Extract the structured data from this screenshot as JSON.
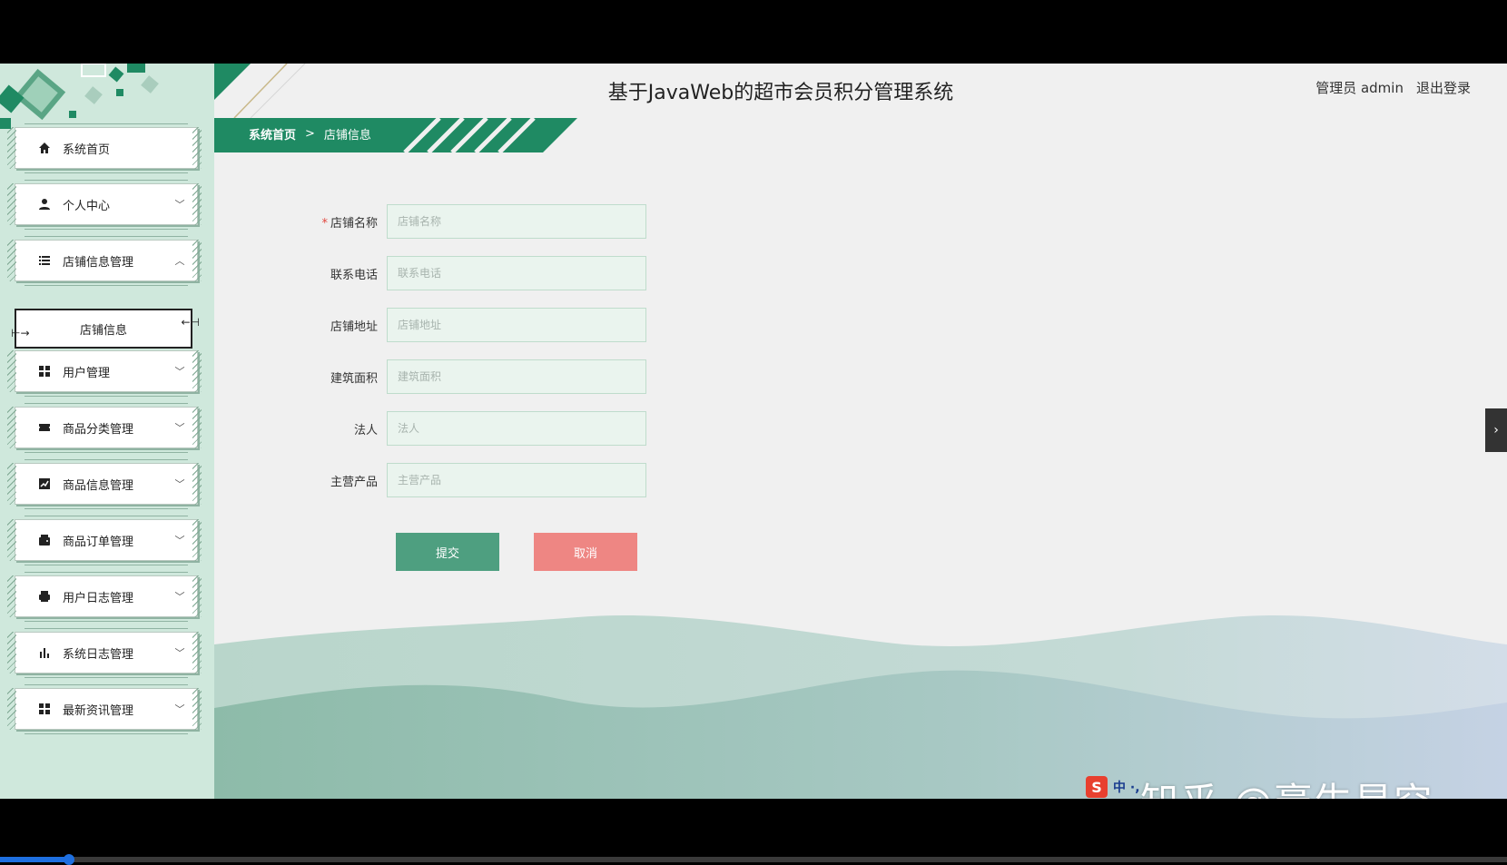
{
  "header": {
    "title": "基于JavaWeb的超市会员积分管理系统",
    "user_label": "管理员 admin",
    "logout_label": "退出登录"
  },
  "breadcrumb": {
    "home": "系统首页",
    "separator": ">",
    "current": "店铺信息"
  },
  "sidebar": {
    "items": [
      {
        "label": "系统首页",
        "icon": "home-icon",
        "chevron": ""
      },
      {
        "label": "个人中心",
        "icon": "user-icon",
        "chevron": "﹀"
      },
      {
        "label": "店铺信息管理",
        "icon": "list-icon",
        "chevron": "︿"
      },
      {
        "label": "用户管理",
        "icon": "grid-icon",
        "chevron": "﹀"
      },
      {
        "label": "商品分类管理",
        "icon": "ticket-icon",
        "chevron": "﹀"
      },
      {
        "label": "商品信息管理",
        "icon": "chart-icon",
        "chevron": "﹀"
      },
      {
        "label": "商品订单管理",
        "icon": "wallet-icon",
        "chevron": "﹀"
      },
      {
        "label": "用户日志管理",
        "icon": "printer-icon",
        "chevron": "﹀"
      },
      {
        "label": "系统日志管理",
        "icon": "bar-chart-icon",
        "chevron": "﹀"
      },
      {
        "label": "最新资讯管理",
        "icon": "grid-icon",
        "chevron": "﹀"
      }
    ],
    "submenu": {
      "label": "店铺信息"
    }
  },
  "form": {
    "fields": [
      {
        "label": "店铺名称",
        "placeholder": "店铺名称",
        "required": "*"
      },
      {
        "label": "联系电话",
        "placeholder": "联系电话",
        "required": ""
      },
      {
        "label": "店铺地址",
        "placeholder": "店铺地址",
        "required": ""
      },
      {
        "label": "建筑面积",
        "placeholder": "建筑面积",
        "required": ""
      },
      {
        "label": "法人",
        "placeholder": "法人",
        "required": ""
      },
      {
        "label": "主营产品",
        "placeholder": "主营产品",
        "required": ""
      }
    ],
    "submit_label": "提交",
    "cancel_label": "取消"
  },
  "overlay": {
    "watermark": "知乎 @豪生星空",
    "ime_logo": "S",
    "ime_text": "中 ·,"
  },
  "video_progress": 0.046,
  "colors": {
    "accent_green": "#1f8a63",
    "sidebar_bg": "#cfe8dc",
    "submit_button": "#4e9f80",
    "cancel_button": "#ee8683",
    "required_mark": "#e2463e"
  }
}
